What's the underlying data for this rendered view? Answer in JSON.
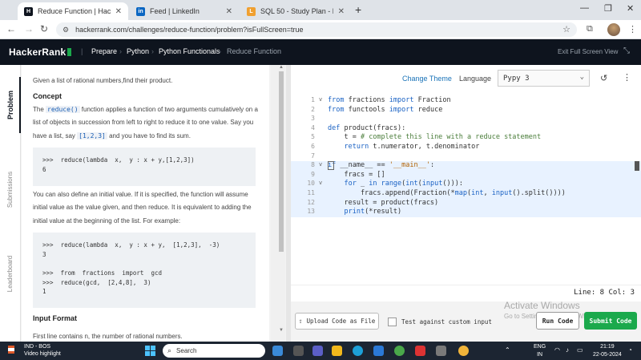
{
  "browser": {
    "tabs": [
      {
        "label": "Reduce Function | HackerRank",
        "favicon": "hackerrank-icon"
      },
      {
        "label": "Feed | LinkedIn",
        "favicon": "linkedin-icon"
      },
      {
        "label": "SQL 50 - Study Plan - LeetCode",
        "favicon": "leetcode-icon"
      }
    ],
    "url": "hackerrank.com/challenges/reduce-function/problem?isFullScreen=true"
  },
  "header": {
    "brand": "HackerRank",
    "breadcrumbs": [
      "Prepare",
      "Python",
      "Python Functionals",
      "Reduce Function"
    ],
    "exit_fullscreen": "Exit Full Screen View"
  },
  "sidebar": {
    "tabs": [
      "Problem",
      "Submissions",
      "Leaderboard"
    ]
  },
  "problem": {
    "intro": "Given a list of rational numbers,find their product.",
    "concept_heading": "Concept",
    "concept_p1_a": "The ",
    "concept_p1_code": "reduce()",
    "concept_p1_b": " function applies a function of two arguments cumulatively on a list of objects in succession from left to right to reduce it to one value. Say you have a list, say ",
    "concept_p1_code2": "[1,2,3]",
    "concept_p1_c": " and you have to find its sum.",
    "code1": ">>>  reduce(lambda  x,  y : x + y,[1,2,3])\n6",
    "p2": "You can also define an initial value. If it is specified, the function will assume initial value as the value given, and then reduce. It is equivalent to adding the initial value at the beginning of the list. For example:",
    "code2": ">>>  reduce(lambda  x,  y : x + y,  [1,2,3],  -3)\n3\n\n>>>  from  fractions  import  gcd\n>>>  reduce(gcd,  [2,4,8],  3)\n1",
    "input_heading": "Input Format",
    "input_p": "First line contains n, the number of rational numbers."
  },
  "editor": {
    "change_theme": "Change Theme",
    "language_label": "Language",
    "language_value": "Pypy 3",
    "status": "Line: 8  Col: 3"
  },
  "actions": {
    "upload": "Upload Code as File",
    "custom_input": "Test against custom input",
    "run": "Run Code",
    "submit": "Submit Code",
    "watermark_title": "Activate Windows",
    "watermark_sub": "Go to Settings to activate Windows."
  },
  "taskbar": {
    "weather_line1": "IND - BOS",
    "weather_line2": "Video highlight",
    "search_placeholder": "Search",
    "lang1": "ENG",
    "lang2": "IN",
    "time": "21:19",
    "date": "22-05-2024"
  },
  "colors": {
    "hr_dark": "#0e141e",
    "hr_green": "#1ba94c",
    "link_blue": "#1a73b8"
  }
}
